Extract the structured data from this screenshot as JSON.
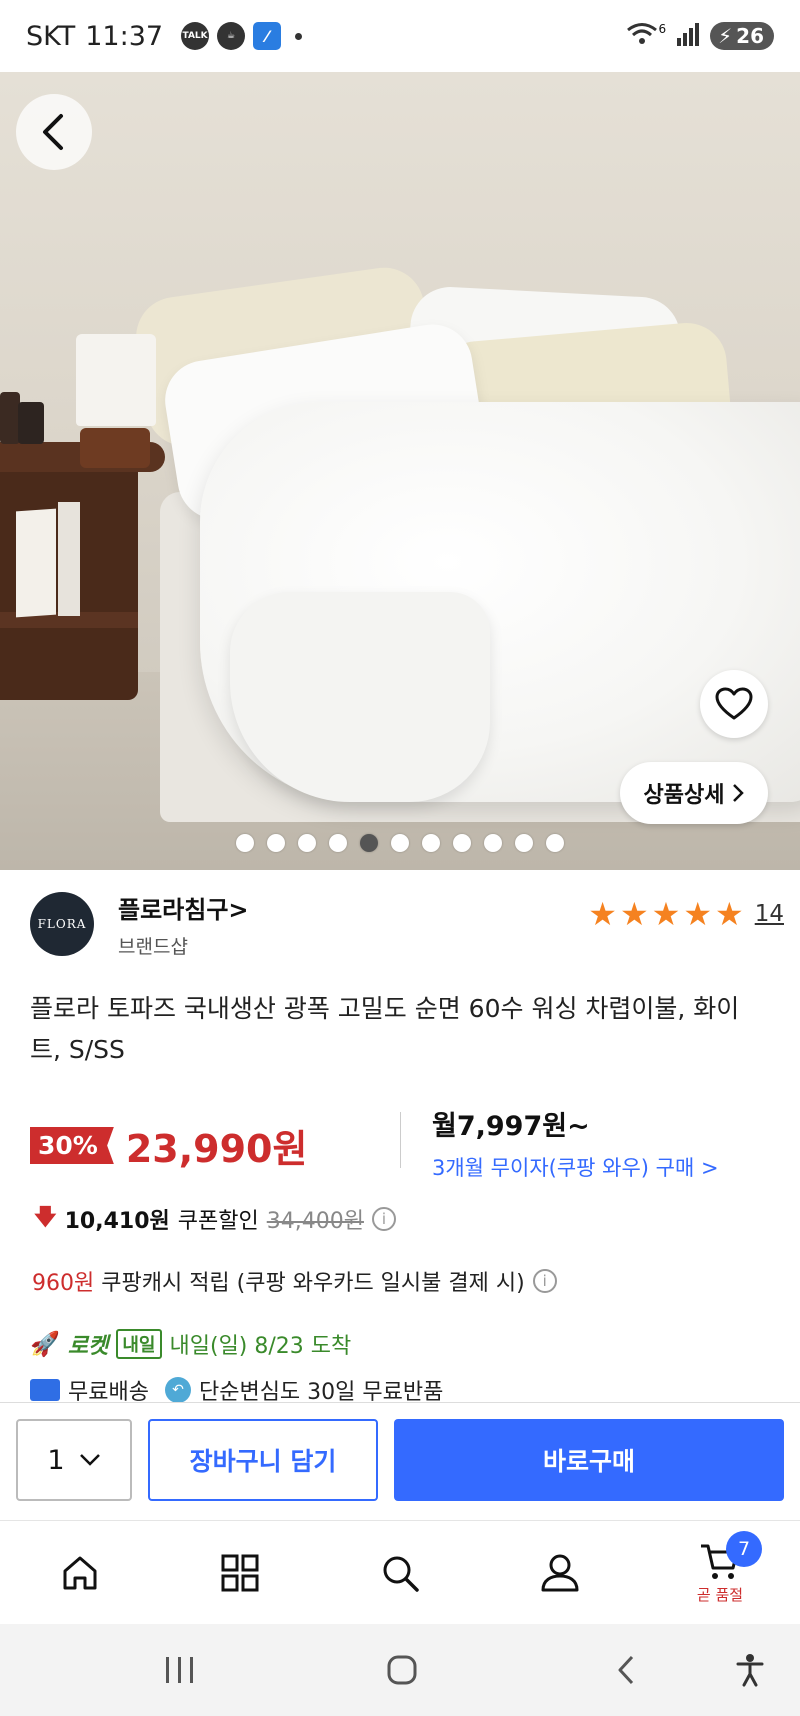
{
  "status_bar": {
    "carrier": "SKT",
    "time": "11:37",
    "notif_talk": "TALK",
    "wifi_label": "6",
    "battery": "26"
  },
  "hero": {
    "detail_button_label": "상품상세",
    "image_count": 11,
    "active_image_index": 5
  },
  "seller": {
    "logo_text": "FLORA",
    "name": "플로라침구>",
    "subtitle": "브랜드샵",
    "rating_stars": 5,
    "review_count": "14"
  },
  "product": {
    "title": "플로라 토파즈 국내생산 광폭 고밀도 순면 60수 워싱 차렵이불, 화이트, S/SS"
  },
  "price": {
    "discount_rate": "30%",
    "sale_price": "23,990원",
    "monthly": "월7,997원~",
    "installment": "3개월 무이자(쿠팡 와우) 구매 >",
    "coupon_amount": "10,410원",
    "coupon_label": "쿠폰할인",
    "original_price": "34,400원",
    "cash_amount": "960원",
    "cash_label": "쿠팡캐시 적립 (쿠팡 와우카드 일시불 결제 시)"
  },
  "delivery": {
    "rocket_label": "로켓",
    "rocket_tag": "내일",
    "arrival": "내일(일) 8/23 도착",
    "free_shipping": "무료배송",
    "free_return": "단순변심도 30일 무료반품"
  },
  "purchase": {
    "quantity": "1",
    "cart_button": "장바구니 담기",
    "buy_button": "바로구매"
  },
  "bottom_nav": {
    "cart_badge": "7",
    "cart_label": "곧 품절"
  },
  "colors": {
    "accent_blue": "#346aff",
    "sale_red": "#cd2d2d",
    "star_orange": "#f58220",
    "rocket_green": "#3a8a2b"
  }
}
